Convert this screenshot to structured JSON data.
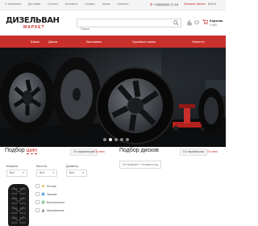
{
  "topbar": {
    "links": [
      "О компании",
      "Доставка",
      "Оплата",
      "Контакты",
      "Сервис",
      "Акции",
      "Новости"
    ],
    "phone": "+7(962)500-17-18",
    "callback": "Заказать звонок",
    "signin": "Войти"
  },
  "header": {
    "logo_main": "ДИЗЕЛЬВАН",
    "logo_sub": "МАРКЕТ",
    "search_placeholder": "Поиск",
    "cart_label": "Корзина",
    "cart_value": "0 руб."
  },
  "nav": {
    "items": [
      "Шины",
      "Диски",
      "Автошины",
      "Грузовые шины",
      "Новости"
    ]
  },
  "hero": {
    "slides": 5,
    "active_slide": 1
  },
  "tires_filter": {
    "title_prefix": "Подбор ",
    "title_accent": "шин",
    "tab_active": "По параметрам",
    "tab_other": "По авто",
    "labels": [
      "Ширина",
      "Высота",
      "Диаметр"
    ],
    "select_value": "Все",
    "seasons": [
      "Летние",
      "Зимние",
      "Всесезонные",
      "Шипованные"
    ]
  },
  "disks_filter": {
    "title": "Подбор дисков",
    "tab_active": "По параметрам",
    "tab_other": "По авто",
    "select_placeholder": "Не выбрано / Неизвестно"
  },
  "colors": {
    "accent": "#c9302c",
    "dark": "#16191c"
  }
}
